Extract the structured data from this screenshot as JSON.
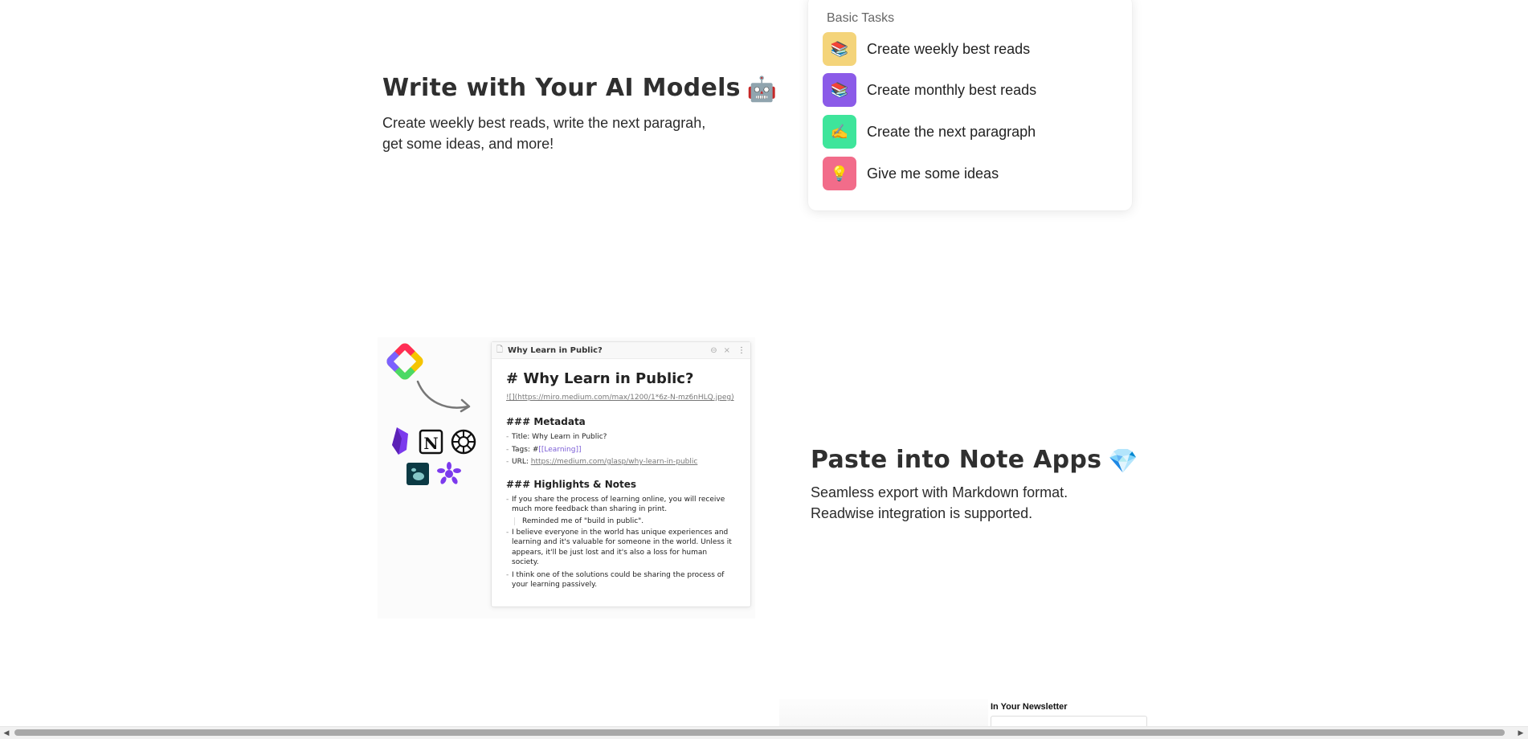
{
  "section_ai": {
    "heading": "Write with Your AI Models",
    "heading_emoji": "🤖",
    "subtitle_line1": "Create weekly best reads, write the next paragrah,",
    "subtitle_line2": "get some ideas, and more!",
    "tasks_title": "Basic Tasks",
    "tasks": [
      {
        "label": "Create weekly best reads",
        "emoji": "📚",
        "color": "#f4d47a",
        "icon": "books-icon"
      },
      {
        "label": "Create monthly best reads",
        "emoji": "📚",
        "color": "#8b5be8",
        "icon": "books-icon"
      },
      {
        "label": "Create the next paragraph",
        "emoji": "✍️",
        "color": "#3ee59b",
        "icon": "writing-hand-icon"
      },
      {
        "label": "Give me some ideas",
        "emoji": "💡",
        "color": "#f26c8a",
        "icon": "lightbulb-icon"
      }
    ]
  },
  "section_export": {
    "heading": "Paste into Note Apps",
    "heading_emoji": "💎",
    "subtitle_line1": "Seamless export with Markdown format.",
    "subtitle_line2": "Readwise integration is supported.",
    "note": {
      "tab_title": "Why Learn in Public?",
      "h1": "# Why Learn in Public?",
      "image_link": "![](https://miro.medium.com/max/1200/1*6z-N-mz6nHLQ.jpeg)",
      "metadata_heading": "### Metadata",
      "meta_title": "Title: Why Learn in Public?",
      "meta_tags_prefix": "Tags: #",
      "meta_tags_value": "[[Learning]]",
      "meta_url_prefix": "URL: ",
      "meta_url_value": "https://medium.com/glasp/why-learn-in-public",
      "highlights_heading": "### Highlights & Notes",
      "highlight1": "If you share the process of learning online, you will receive much more feedback than sharing in print.",
      "highlight1_note": "Reminded me of \"build in public\".",
      "highlight2": "I believe everyone in the world has unique experiences and learning and it's valuable for someone in the world. Unless it appears, it'll be just lost and it's also a loss for human society.",
      "highlight3": "I think one of the solutions could be sharing the process of your learning passively."
    }
  },
  "section_newsletter": {
    "title": "In Your Newsletter"
  }
}
